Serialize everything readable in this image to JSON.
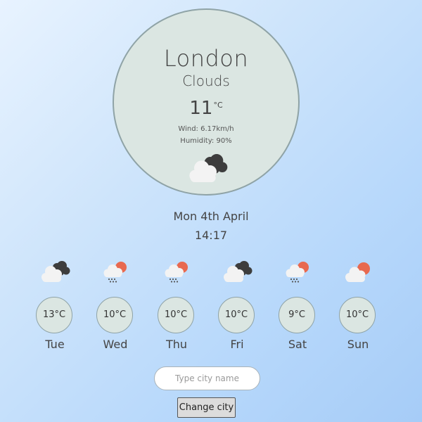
{
  "current": {
    "city": "London",
    "condition": "Clouds",
    "temp": "11",
    "temp_unit": "°C",
    "wind": "Wind: 6.17km/h",
    "humidity": "Humidity: 90%",
    "icon": "cloud-dark-cloud-icon"
  },
  "date": "Mon 4th April",
  "time": "14:17",
  "forecast": [
    {
      "day": "Tue",
      "temp": "13°C",
      "icon": "cloud-dark-cloud-icon"
    },
    {
      "day": "Wed",
      "temp": "10°C",
      "icon": "sun-cloud-rain-icon"
    },
    {
      "day": "Thu",
      "temp": "10°C",
      "icon": "sun-cloud-rain-icon"
    },
    {
      "day": "Fri",
      "temp": "10°C",
      "icon": "cloud-dark-cloud-icon"
    },
    {
      "day": "Sat",
      "temp": "9°C",
      "icon": "sun-cloud-rain-icon"
    },
    {
      "day": "Sun",
      "temp": "10°C",
      "icon": "sun-cloud-icon"
    }
  ],
  "search": {
    "placeholder": "Type city name",
    "value": "",
    "button_label": "Change city"
  },
  "colors": {
    "bubble_fill": "#dbe6e2",
    "bubble_border": "#8fa3a6",
    "sun": "#e8694f",
    "dark_cloud": "#3d3d3d",
    "light_cloud": "#f2f2f2",
    "rain": "#555555"
  }
}
